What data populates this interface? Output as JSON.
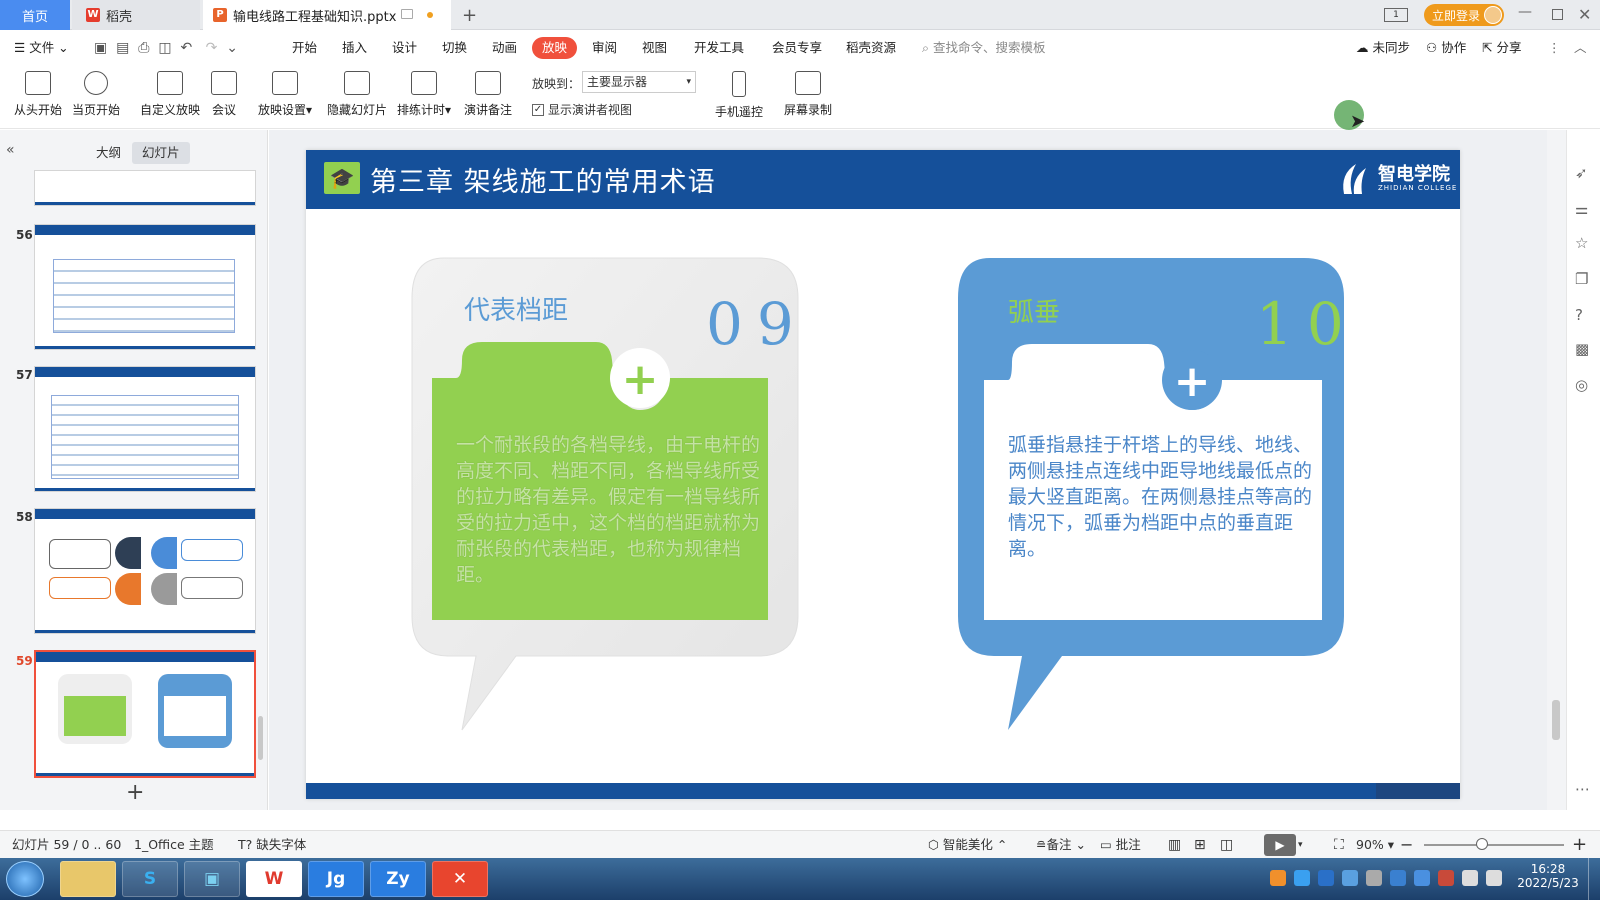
{
  "tabs": {
    "home": "首页",
    "daoke": "稻壳",
    "file": "输电线路工程基础知识.pptx",
    "login": "立即登录"
  },
  "menu": {
    "file": "文件",
    "items": [
      "开始",
      "插入",
      "设计",
      "切换",
      "动画",
      "放映",
      "审阅",
      "视图",
      "开发工具",
      "会员专享",
      "稻壳资源"
    ],
    "search_placeholder": "查找命令、搜索模板",
    "sync": "未同步",
    "collab": "协作",
    "share": "分享"
  },
  "toolbar": {
    "from_start": "从头开始",
    "from_current": "当页开始",
    "custom_show": "自定义放映",
    "meeting": "会议",
    "show_settings": "放映设置",
    "hide_slide": "隐藏幻灯片",
    "rehearse": "排练计时",
    "speaker_notes": "演讲备注",
    "show_to_label": "放映到：",
    "show_to_value": "主要显示器",
    "presenter_view": "显示演讲者视图",
    "phone_remote": "手机遥控",
    "screen_record": "屏幕录制"
  },
  "left_panel": {
    "tab_outline": "大纲",
    "tab_slides": "幻灯片",
    "slide_numbers": [
      "56",
      "57",
      "58",
      "59"
    ]
  },
  "slide": {
    "title": "第三章  架线施工的常用术语",
    "logo_text": "智电学院",
    "logo_sub": "ZHIDIAN COLLEGE",
    "card1": {
      "title": "代表档距",
      "number": "09",
      "text": "一个耐张段的各档导线，由于电杆的高度不同、档距不同，各档导线所受的拉力略有差异。假定有一档导线所受的拉力适中，这个档的档距就称为耐张段的代表档距，也称为规律档距。"
    },
    "card2": {
      "title": "弧垂",
      "number": "10",
      "text": "弧垂指悬挂于杆塔上的导线、地线、两侧悬挂点连线中距导地线最低点的最大竖直距离。在两侧悬挂点等高的情况下，弧垂为档距中点的垂直距离。"
    }
  },
  "status": {
    "slide_info": "幻灯片 59 / 0 .. 60",
    "theme": "1_Office 主题",
    "missing_font": "缺失字体",
    "smart_beautify": "智能美化",
    "notes": "备注",
    "comments": "批注",
    "zoom": "90%"
  },
  "taskbar": {
    "time": "16:28",
    "date": "2022/5/23"
  },
  "colors": {
    "accent_red": "#f0503c",
    "slide_blue": "#15509a",
    "card_green": "#92d050",
    "card_blue": "#5b9bd5"
  }
}
